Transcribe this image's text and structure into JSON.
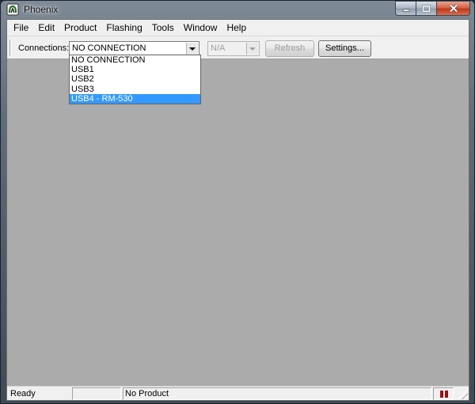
{
  "window": {
    "title": "Phoenix"
  },
  "menubar": {
    "items": [
      "File",
      "Edit",
      "Product",
      "Flashing",
      "Tools",
      "Window",
      "Help"
    ]
  },
  "toolbar": {
    "connections_label": "Connections:",
    "connection_value": "NO CONNECTION",
    "secondary_value": "N/A",
    "refresh_label": "Refresh",
    "settings_label": "Settings..."
  },
  "dropdown": {
    "options": [
      "NO CONNECTION",
      "USB1",
      "USB2",
      "USB3",
      "USB4 - RM-530"
    ],
    "highlighted": "USB4 - RM-530"
  },
  "statusbar": {
    "ready": "Ready",
    "blank": "",
    "product": "No Product"
  },
  "colors": {
    "selection": "#3399ff",
    "workspace": "#ababab",
    "indicator": "#9a1010"
  }
}
